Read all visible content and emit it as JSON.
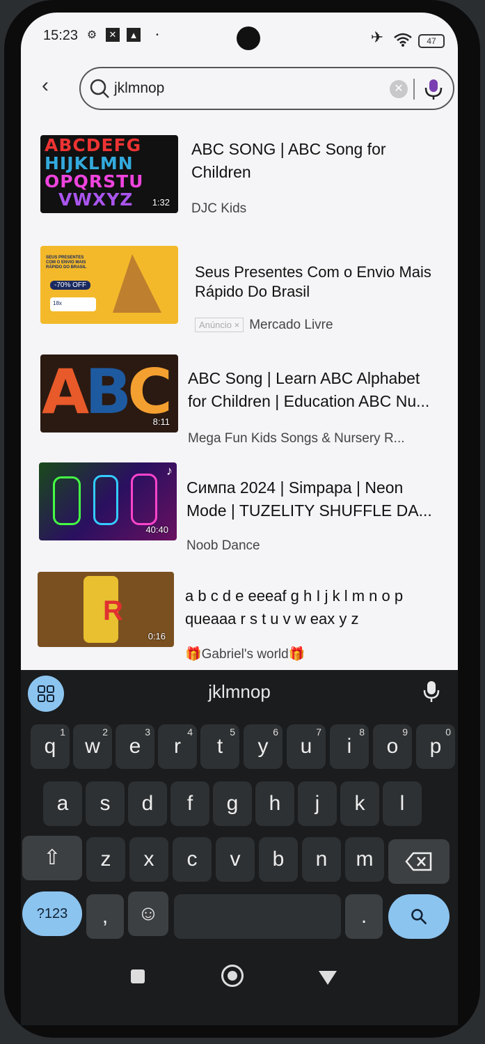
{
  "status": {
    "time": "15:23",
    "battery": "47"
  },
  "search": {
    "query": "jklmnop"
  },
  "results": [
    {
      "title_line1": "ABC SONG | ABC Song for",
      "title_line2": "Children",
      "channel": "DJC Kids",
      "duration": "1:32",
      "ad": ""
    },
    {
      "title_line1": "Seus Presentes Com o Envio Mais",
      "title_line2": "Rápido Do Brasil",
      "channel": "Mercado Livre",
      "duration": "",
      "ad": "Anúncio ×"
    },
    {
      "title_line1": "ABC Song | Learn ABC Alphabet",
      "title_line2": "for Children | Education ABC Nu...",
      "channel": "Mega Fun Kids Songs & Nursery R...",
      "duration": "8:11",
      "ad": ""
    },
    {
      "title_line1": "Симпа 2024 | Simpapa | Neon",
      "title_line2": "Mode | TUZELITY SHUFFLE DA...",
      "channel": "Noob Dance",
      "duration": "40:40",
      "ad": ""
    },
    {
      "title_line1": "a b c d e eeeaf g h I j k l m n o p",
      "title_line2": "queaaa r s t u v w eax y z",
      "channel": "🎁Gabriel's world🎁",
      "duration": "0:16",
      "ad": ""
    }
  ],
  "thumb_text": {
    "abc_row1": "ABCDEFG",
    "abc_row2": "HIJKLMN",
    "abc_row3": "OPQRSTU",
    "abc_row4": "VWXYZ",
    "ad_line1": "SEUS PRESENTES",
    "ad_line2": "COM O ENVIO MAIS",
    "ad_line3": "RÁPIDO DO BRASIL",
    "ad_discount": "-70% OFF",
    "ad_installments": "18x",
    "abc_big": "ABC"
  },
  "keyboard": {
    "suggestion": "jklmnop",
    "row1": [
      {
        "k": "q",
        "n": "1"
      },
      {
        "k": "w",
        "n": "2"
      },
      {
        "k": "e",
        "n": "3"
      },
      {
        "k": "r",
        "n": "4"
      },
      {
        "k": "t",
        "n": "5"
      },
      {
        "k": "y",
        "n": "6"
      },
      {
        "k": "u",
        "n": "7"
      },
      {
        "k": "i",
        "n": "8"
      },
      {
        "k": "o",
        "n": "9"
      },
      {
        "k": "p",
        "n": "0"
      }
    ],
    "row2": [
      "a",
      "s",
      "d",
      "f",
      "g",
      "h",
      "j",
      "k",
      "l"
    ],
    "row3": [
      "z",
      "x",
      "c",
      "v",
      "b",
      "n",
      "m"
    ],
    "symbols": "?123",
    "comma": ",",
    "period": "."
  },
  "colors": {
    "accent": "#8cc4f0",
    "keyboard_bg": "#1a1c1e",
    "screen_bg": "#f5f5f7"
  }
}
